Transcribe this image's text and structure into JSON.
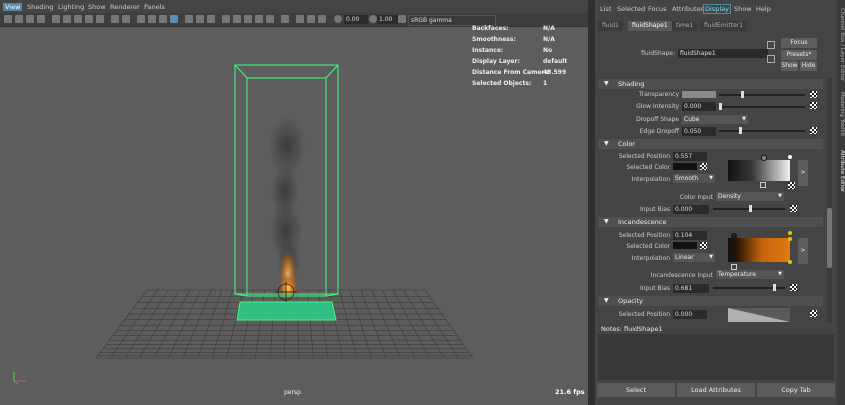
{
  "viewport": {
    "menu": [
      "View",
      "Shading",
      "Lighting",
      "Show",
      "Renderer",
      "Panels"
    ],
    "toolbar": {
      "exposure": "0.00",
      "gamma": "1.00",
      "color_space": "sRGB gamma"
    },
    "hud": [
      {
        "k": "Backfaces:",
        "v": "N/A"
      },
      {
        "k": "Smoothness:",
        "v": "N/A"
      },
      {
        "k": "Instance:",
        "v": "No"
      },
      {
        "k": "Display Layer:",
        "v": "default"
      },
      {
        "k": "Distance From Camera:",
        "v": "48.599"
      },
      {
        "k": "Selected Objects:",
        "v": "1"
      }
    ],
    "camera": "persp",
    "fps": "21.6 fps"
  },
  "ae": {
    "menu": [
      "List",
      "Selected",
      "Focus",
      "Attributes",
      "Display",
      "Show",
      "Help"
    ],
    "tabs": [
      "fluid1",
      "fluidShape1",
      "time1",
      "fluidEmitter1"
    ],
    "node_label": "fluidShape:",
    "node_name": "fluidShape1",
    "focus": "Focus",
    "presets": "Presets*",
    "show": "Show",
    "hide": "Hide",
    "shading": {
      "title": "Shading",
      "transparency_label": "Transparency",
      "glow_label": "Glow Intensity",
      "glow_value": "0.000",
      "dropoff_label": "Dropoff Shape",
      "dropoff_value": "Cube",
      "edge_label": "Edge Dropoff",
      "edge_value": "0.050"
    },
    "color": {
      "title": "Color",
      "pos_label": "Selected Position",
      "pos_value": "0.557",
      "col_label": "Selected Color",
      "interp_label": "Interpolation",
      "interp_value": "Smooth",
      "input_label": "Color Input",
      "input_value": "Density",
      "bias_label": "Input Bias",
      "bias_value": "0.000"
    },
    "incand": {
      "title": "Incandescence",
      "pos_label": "Selected Position",
      "pos_value": "0.104",
      "col_label": "Selected Color",
      "interp_label": "Interpolation",
      "interp_value": "Linear",
      "input_label": "Incandescence Input",
      "input_value": "Temperature",
      "bias_label": "Input Bias",
      "bias_value": "0.681"
    },
    "opacity": {
      "title": "Opacity",
      "pos_label": "Selected Position",
      "pos_value": "0.000"
    },
    "notes_label": "Notes:  fluidShape1",
    "buttons": [
      "Select",
      "Load Attributes",
      "Copy Tab"
    ],
    "side_tabs": [
      "Channel Box / Layer Editor",
      "Modeling Toolkit",
      "Attribute Editor"
    ],
    "colors": {
      "selection_green": "#3cff7a",
      "incandescence": "#e07a10",
      "accent_blue": "#5285a6"
    }
  }
}
